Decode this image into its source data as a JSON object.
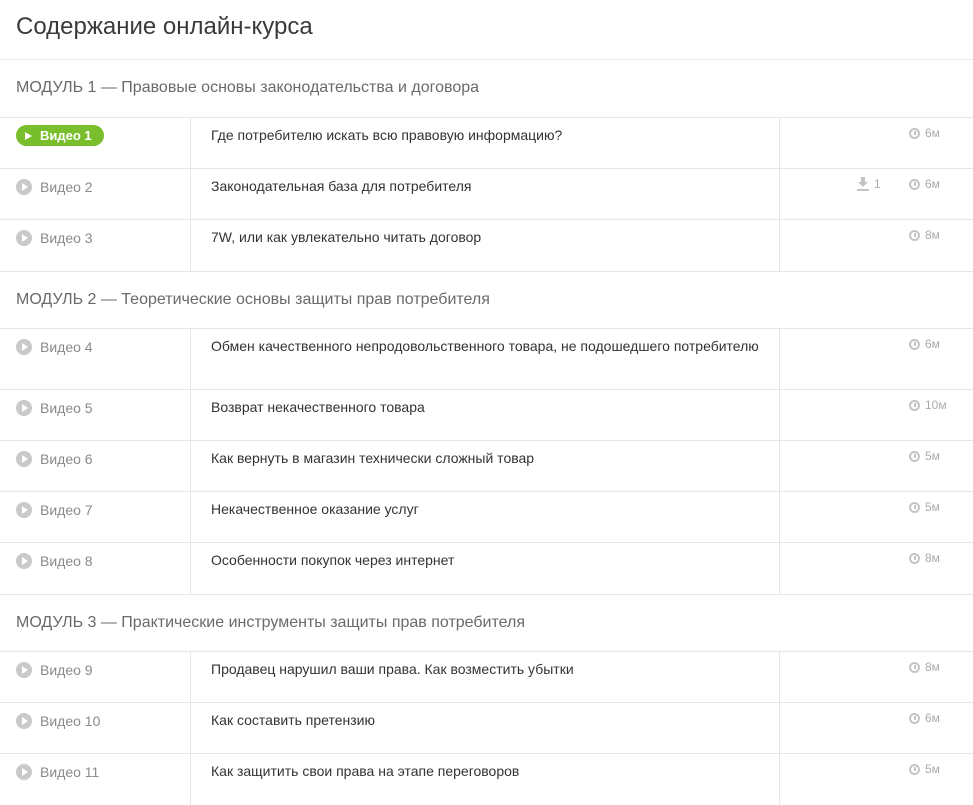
{
  "page_title": "Содержание онлайн-курса",
  "modules": [
    {
      "title": "МОДУЛЬ 1 — Правовые основы законодательства и договора",
      "videos": [
        {
          "label": "Видео 1",
          "title": "Где потребителю искать всю правовую информацию?",
          "duration": "6м",
          "active": true
        },
        {
          "label": "Видео 2",
          "title": "Законодательная база для потребителя",
          "duration": "6м",
          "downloads": "1"
        },
        {
          "label": "Видео 3",
          "title": "7W, или как увлекательно читать договор",
          "duration": "8м"
        }
      ]
    },
    {
      "title": "МОДУЛЬ 2 — Теоретические основы защиты прав потребителя",
      "videos": [
        {
          "label": "Видео 4",
          "title": "Обмен качественного непродовольственного товара, не подошедшего потребителю",
          "duration": "6м"
        },
        {
          "label": "Видео 5",
          "title": "Возврат некачественного товара",
          "duration": "10м"
        },
        {
          "label": "Видео 6",
          "title": "Как вернуть в магазин технически сложный товар",
          "duration": "5м"
        },
        {
          "label": "Видео 7",
          "title": "Некачественное оказание услуг",
          "duration": "5м"
        },
        {
          "label": "Видео 8",
          "title": "Особенности покупок через интернет",
          "duration": "8м"
        }
      ]
    },
    {
      "title": "МОДУЛЬ 3 — Практические инструменты защиты прав потребителя",
      "videos": [
        {
          "label": "Видео 9",
          "title": "Продавец нарушил ваши права. Как возместить убытки",
          "duration": "8м"
        },
        {
          "label": "Видео 10",
          "title": "Как составить претензию",
          "duration": "6м"
        },
        {
          "label": "Видео 11",
          "title": "Как защитить свои права на этапе переговоров",
          "duration": "5м"
        }
      ]
    }
  ],
  "colors": {
    "accent": "#79bf2d",
    "icon_gray": "#c4c4c4"
  },
  "icons": {
    "play": "play-icon",
    "clock": "clock-icon",
    "download": "download-icon"
  }
}
